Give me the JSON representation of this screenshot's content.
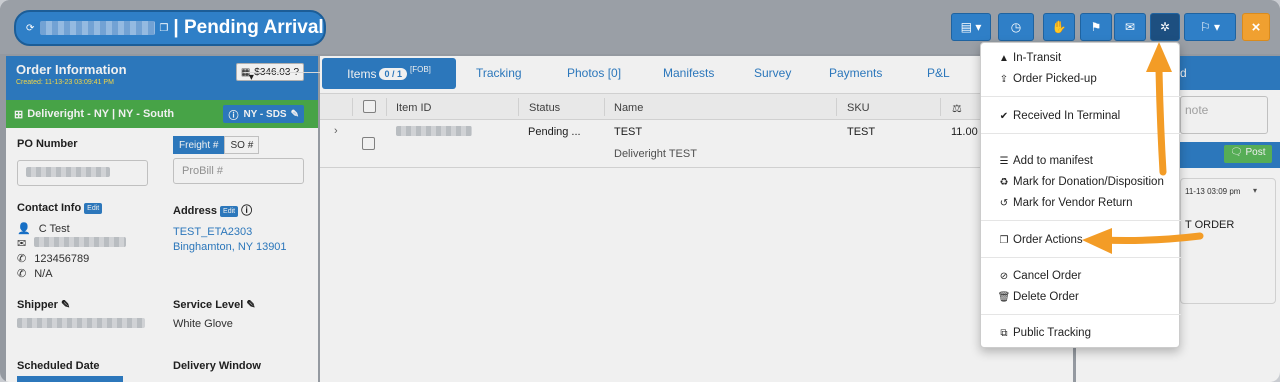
{
  "header": {
    "title": "| Pending Arrival",
    "close_label": "×"
  },
  "order_info": {
    "heading": "Order Information",
    "created": "Created: 11-13-23 03:09:41 PM",
    "balance": "$346.03",
    "agent": "Deliveright - NY | NY - South",
    "agent_chip": "NY - SDS",
    "po_label": "PO Number",
    "freight_tab": "Freight #",
    "so_tab": "SO #",
    "probill_placeholder": "ProBill #",
    "contact_label": "Contact Info",
    "edit_label": "Edit",
    "contact_name": "C Test",
    "contact_phone": "123456789",
    "contact_alt": "N/A",
    "address_label": "Address",
    "address_line1": "TEST_ETA2303",
    "address_line2": "Binghamton, NY 13901",
    "shipper_label": "Shipper",
    "service_label": "Service Level",
    "service_value": "White Glove",
    "scheduled_label": "Scheduled Date",
    "window_label": "Delivery Window"
  },
  "tabs": {
    "items": "Items",
    "items_count": "0 / 1",
    "fob": "[FOB]",
    "tracking": "Tracking",
    "photos": "Photos [0]",
    "manifests": "Manifests",
    "survey": "Survey",
    "payments": "Payments",
    "pl": "P&L"
  },
  "table": {
    "headers": [
      "Item ID",
      "Status",
      "Name",
      "SKU"
    ],
    "row": {
      "status": "Pending ...",
      "name": "TEST",
      "sku": "TEST",
      "weight": "11.00",
      "subname": "Deliveright TEST"
    }
  },
  "notes": {
    "header_suffix": "d",
    "placeholder": "note",
    "post": "Post",
    "time": "11-13 03:09 pm",
    "text": "T ORDER"
  },
  "menu": {
    "items": [
      {
        "icon": "road-icon",
        "label": "In-Transit"
      },
      {
        "icon": "upload-icon",
        "label": "Order Picked-up"
      },
      {
        "icon": "check-icon",
        "label": "Received In Terminal"
      },
      {
        "icon": "list-icon",
        "label": "Add to manifest"
      },
      {
        "icon": "recycle-icon",
        "label": "Mark for Donation/Disposition"
      },
      {
        "icon": "undo-icon",
        "label": "Mark for Vendor Return"
      },
      {
        "icon": "copy-icon",
        "label": "Order Actions"
      },
      {
        "icon": "ban-icon",
        "label": "Cancel Order"
      },
      {
        "icon": "trash-icon",
        "label": "Delete Order"
      },
      {
        "icon": "external-link-icon",
        "label": "Public Tracking"
      }
    ]
  },
  "colors": {
    "primary": "#2f7fc7",
    "success": "#4cae4c",
    "accent": "#f0a030"
  }
}
